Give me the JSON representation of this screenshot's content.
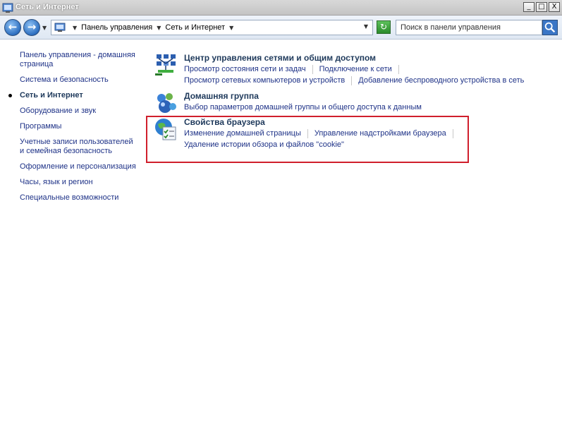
{
  "window": {
    "title": "Сеть и Интернет",
    "buttons": {
      "minimize": "_",
      "maximize": "□",
      "close": "X"
    }
  },
  "nav": {
    "back_glyph": "←",
    "forward_glyph": "→",
    "crumbs": [
      "Панель управления",
      "Сеть и Интернет"
    ],
    "search_placeholder": "Поиск в панели управления"
  },
  "sidebar": {
    "items": [
      {
        "label": "Панель управления - домашняя страница"
      },
      {
        "label": "Система и безопасность"
      },
      {
        "label": "Сеть и Интернет",
        "current": true
      },
      {
        "label": "Оборудование и звук"
      },
      {
        "label": "Программы"
      },
      {
        "label": "Учетные записи пользователей и семейная безопасность"
      },
      {
        "label": "Оформление и персонализация"
      },
      {
        "label": "Часы, язык и регион"
      },
      {
        "label": "Специальные возможности"
      }
    ]
  },
  "sections": [
    {
      "title": "Центр управления сетями и общим доступом",
      "icon": "network-center-icon",
      "rows": [
        [
          "Просмотр состояния сети и задач",
          "Подключение к сети"
        ],
        [
          "Просмотр сетевых компьютеров и устройств",
          "Добавление беспроводного устройства в сеть"
        ]
      ]
    },
    {
      "title": "Домашняя группа",
      "icon": "homegroup-icon",
      "rows": [
        [
          "Выбор параметров домашней группы и общего доступа к данным"
        ]
      ]
    },
    {
      "title": "Свойства браузера",
      "icon": "internet-options-icon",
      "rows": [
        [
          "Изменение домашней страницы",
          "Управление надстройками браузера"
        ],
        [
          "Удаление истории обзора и файлов \"cookie\""
        ]
      ]
    }
  ],
  "colors": {
    "link": "#1e3287",
    "highlight": "#d01f2c"
  }
}
